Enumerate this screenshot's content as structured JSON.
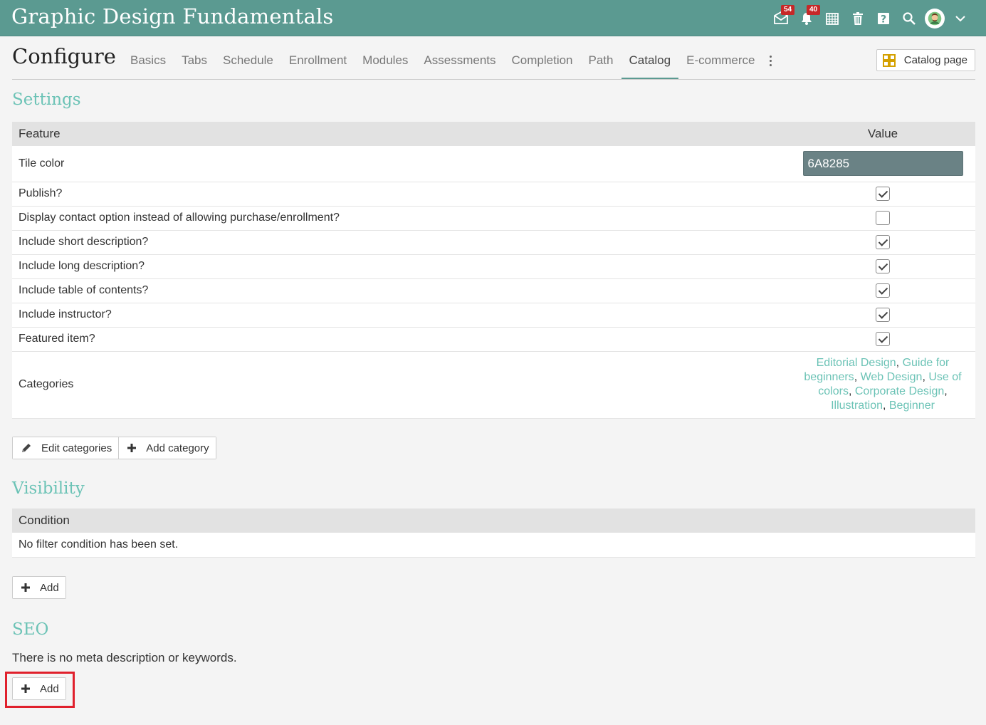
{
  "app": {
    "title": "Graphic Design Fundamentals"
  },
  "topbar": {
    "icons": [
      {
        "name": "messages-icon",
        "badge": "54"
      },
      {
        "name": "notifications-icon",
        "badge": "40"
      },
      {
        "name": "calendar-icon"
      },
      {
        "name": "trash-icon"
      },
      {
        "name": "help-icon"
      },
      {
        "name": "search-icon"
      },
      {
        "name": "avatar"
      },
      {
        "name": "chevron-down-icon"
      }
    ]
  },
  "header": {
    "title": "Configure",
    "tabs": [
      "Basics",
      "Tabs",
      "Schedule",
      "Enrollment",
      "Modules",
      "Assessments",
      "Completion",
      "Path",
      "Catalog",
      "E-commerce"
    ],
    "active_tab": "Catalog",
    "catalog_page_label": "Catalog page"
  },
  "settings": {
    "title": "Settings",
    "columns": {
      "feature": "Feature",
      "value": "Value"
    },
    "tile_color": {
      "label": "Tile color",
      "value": "6A8285"
    },
    "rows": [
      {
        "label": "Publish?",
        "checked": true
      },
      {
        "label": "Display contact option instead of allowing purchase/enrollment?",
        "checked": false
      },
      {
        "label": "Include short description?",
        "checked": true
      },
      {
        "label": "Include long description?",
        "checked": true
      },
      {
        "label": "Include table of contents?",
        "checked": true
      },
      {
        "label": "Include instructor?",
        "checked": true
      },
      {
        "label": "Featured item?",
        "checked": true
      }
    ],
    "categories": {
      "label": "Categories",
      "items": [
        "Editorial Design",
        "Guide for beginners",
        "Web Design",
        "Use of colors",
        "Corporate Design",
        "Illustration",
        "Beginner"
      ]
    },
    "edit_categories_label": "Edit categories",
    "add_category_label": "Add category"
  },
  "visibility": {
    "title": "Visibility",
    "column": "Condition",
    "empty_text": "No filter condition has been set.",
    "add_label": "Add"
  },
  "seo": {
    "title": "SEO",
    "empty_text": "There is no meta description or keywords.",
    "add_label": "Add"
  },
  "colors": {
    "topbar": "#5b9a91",
    "accent": "#6cc3b6",
    "tile": "#6a8285",
    "highlight": "#e0202c"
  }
}
